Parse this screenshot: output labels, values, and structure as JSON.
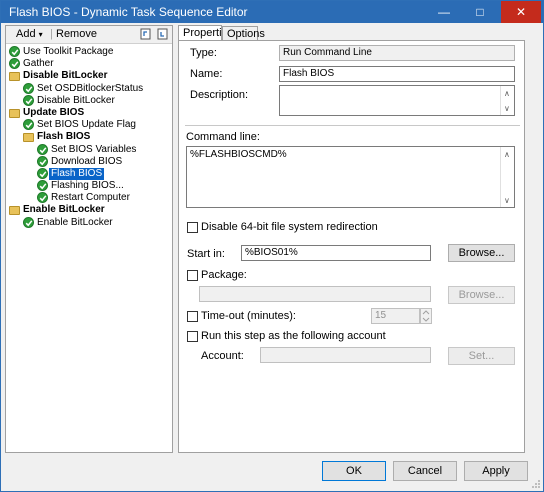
{
  "window": {
    "title": "Flash BIOS - Dynamic Task Sequence Editor",
    "minimize": "—",
    "maximize": "□",
    "close": "✕"
  },
  "toolbar": {
    "add_label": "Add",
    "add_caret": "▾",
    "remove_label": "Remove"
  },
  "tree": [
    {
      "label": "Use Toolkit Package",
      "icon": "check-icon",
      "level": 0,
      "bold": false
    },
    {
      "label": "Gather",
      "icon": "check-icon",
      "level": 0,
      "bold": false
    },
    {
      "label": "Disable BitLocker",
      "icon": "folder-icon",
      "level": 0,
      "bold": true
    },
    {
      "label": "Set OSDBitlockerStatus",
      "icon": "check-icon",
      "level": 1,
      "bold": false
    },
    {
      "label": "Disable BitLocker",
      "icon": "check-icon",
      "level": 1,
      "bold": false
    },
    {
      "label": "Update BIOS",
      "icon": "folder-icon",
      "level": 0,
      "bold": true
    },
    {
      "label": "Set BIOS Update Flag",
      "icon": "check-icon",
      "level": 1,
      "bold": false
    },
    {
      "label": "Flash BIOS",
      "icon": "folder-icon",
      "level": 1,
      "bold": true
    },
    {
      "label": "Set BIOS Variables",
      "icon": "check-icon",
      "level": 2,
      "bold": false
    },
    {
      "label": "Download BIOS",
      "icon": "check-icon",
      "level": 2,
      "bold": false
    },
    {
      "label": "Flash BIOS",
      "icon": "check-icon",
      "level": 2,
      "bold": false,
      "selected": true
    },
    {
      "label": "Flashing BIOS...",
      "icon": "check-icon",
      "level": 2,
      "bold": false
    },
    {
      "label": "Restart Computer",
      "icon": "check-icon",
      "level": 2,
      "bold": false
    },
    {
      "label": "Enable BitLocker",
      "icon": "folder-icon",
      "level": 0,
      "bold": true
    },
    {
      "label": "Enable BitLocker",
      "icon": "check-icon",
      "level": 1,
      "bold": false
    }
  ],
  "tabs": {
    "properties": "Properties",
    "options": "Options",
    "active": "properties"
  },
  "properties": {
    "type_label": "Type:",
    "type_value": "Run Command Line",
    "name_label": "Name:",
    "name_value": "Flash BIOS",
    "description_label": "Description:",
    "description_value": "",
    "command_line_label": "Command line:",
    "command_line_value": "%FLASHBIOSCMD%",
    "disable64_label": "Disable 64-bit file system redirection",
    "disable64_checked": false,
    "start_in_label": "Start in:",
    "start_in_value": "%BIOS01%",
    "browse_label": "Browse...",
    "package_label": "Package:",
    "package_checked": false,
    "package_value": "",
    "package_browse_label": "Browse...",
    "timeout_label": "Time-out (minutes):",
    "timeout_checked": false,
    "timeout_value": "15",
    "run_as_label": "Run this step as the following account",
    "run_as_checked": false,
    "account_label": "Account:",
    "account_value": "",
    "set_label": "Set..."
  },
  "footer": {
    "ok_label": "OK",
    "cancel_label": "Cancel",
    "apply_label": "Apply"
  },
  "colors": {
    "titlebar": "#2b6cb5",
    "selection": "#0a64c8",
    "check_green": "#2e9e3a",
    "close_red": "#c42b1c"
  }
}
